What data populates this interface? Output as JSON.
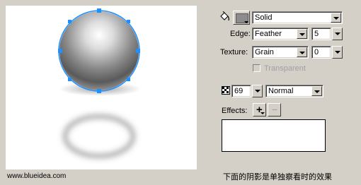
{
  "panel": {
    "fill_style": "Solid",
    "edge_label": "Edge:",
    "edge_value": "Feather",
    "edge_amount": "5",
    "texture_label": "Texture:",
    "texture_value": "Grain",
    "texture_amount": "0",
    "transparent_label": "Transparent",
    "opacity": "69",
    "blend_mode": "Normal",
    "effects_label": "Effects:",
    "add_label": "+",
    "remove_label": "−"
  },
  "colors": {
    "selection": "#1e90ff",
    "swatch": "#8c8c8c"
  },
  "icons": [
    "paint-bucket-icon",
    "opacity-icon"
  ],
  "canvas": {
    "watermark": "www.blueidea.com",
    "caption": "下面的阴影是单独察看时的效果"
  }
}
